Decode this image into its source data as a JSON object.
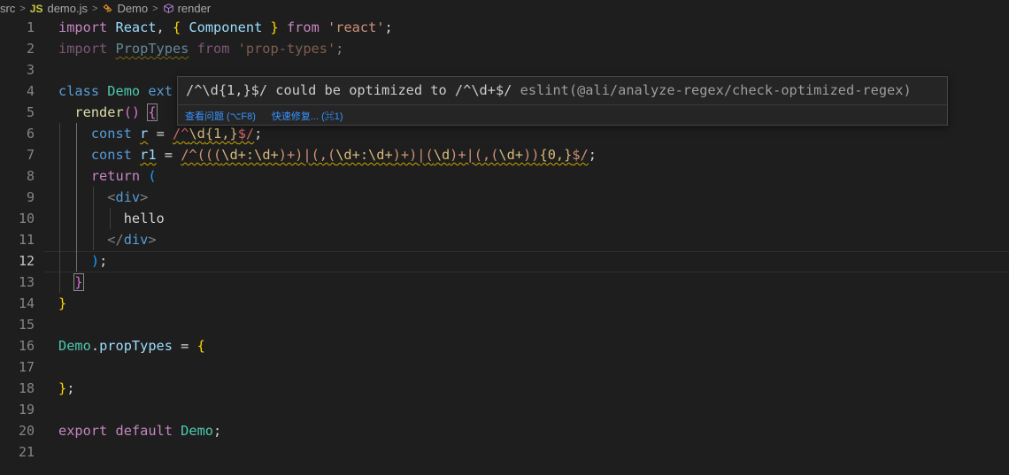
{
  "breadcrumb": {
    "folder": "src",
    "file_badge": "JS",
    "file": "demo.js",
    "class_symbol": "Demo",
    "method_symbol": "render",
    "separator": ">"
  },
  "editor": {
    "active_line": 12,
    "line_numbers": [
      "1",
      "2",
      "3",
      "4",
      "5",
      "6",
      "7",
      "8",
      "9",
      "10",
      "11",
      "12",
      "13",
      "14",
      "15",
      "16",
      "17",
      "18",
      "19",
      "20",
      "21"
    ],
    "tokens": {
      "import": "import",
      "react": "React",
      "comma": ",",
      "lbrace": "{",
      "component": "Component",
      "rbrace": "}",
      "from": "from",
      "react_str": "'react'",
      "semi": ";",
      "proptypes": "PropTypes",
      "proptypes_str": "'prop-types'",
      "class": "class",
      "demo": "Demo",
      "ext": "ext",
      "render": "render",
      "parens": "()",
      "const": "const",
      "r": "r",
      "eq": "=",
      "regex1_open": "/^",
      "regex1_esc": "\\d",
      "regex1_quant": "{1,}",
      "regex1_close": "$/",
      "r1": "r1",
      "regex2_a": "/^(((",
      "regex2_b": "\\d+:\\d+",
      "regex2_c": ")+)|(,(",
      "regex2_d": "\\d+:\\d+",
      "regex2_e": ")+)|(",
      "regex2_f": "\\d",
      "regex2_g": ")+|(,(",
      "regex2_h": "\\d+",
      "regex2_i": "))",
      "regex2_j": "{0,}",
      "regex2_k": "$/",
      "return": "return",
      "lparen": "(",
      "rparen": ")",
      "lt": "<",
      "lt_slash": "</",
      "gt": ">",
      "div": "div",
      "hello": "hello",
      "dot": ".",
      "proptypes_prop": "propTypes",
      "export": "export",
      "default": "default"
    }
  },
  "hover": {
    "message": "/^\\d{1,}$/ could be optimized to /^\\d+$/",
    "source": "eslint(@ali/analyze-regex/check-optimized-regex)",
    "view_problem": "查看问题 (⌥F8)",
    "quick_fix": "快速修复... (⌘1)"
  },
  "colors": {
    "background": "#1e1e1e",
    "keyword": "#569cd6",
    "control": "#c586c0",
    "class": "#4ec9b0",
    "string": "#ce9178",
    "regex": "#d16969",
    "warning_squiggle": "#cca700",
    "link": "#3794ff"
  }
}
